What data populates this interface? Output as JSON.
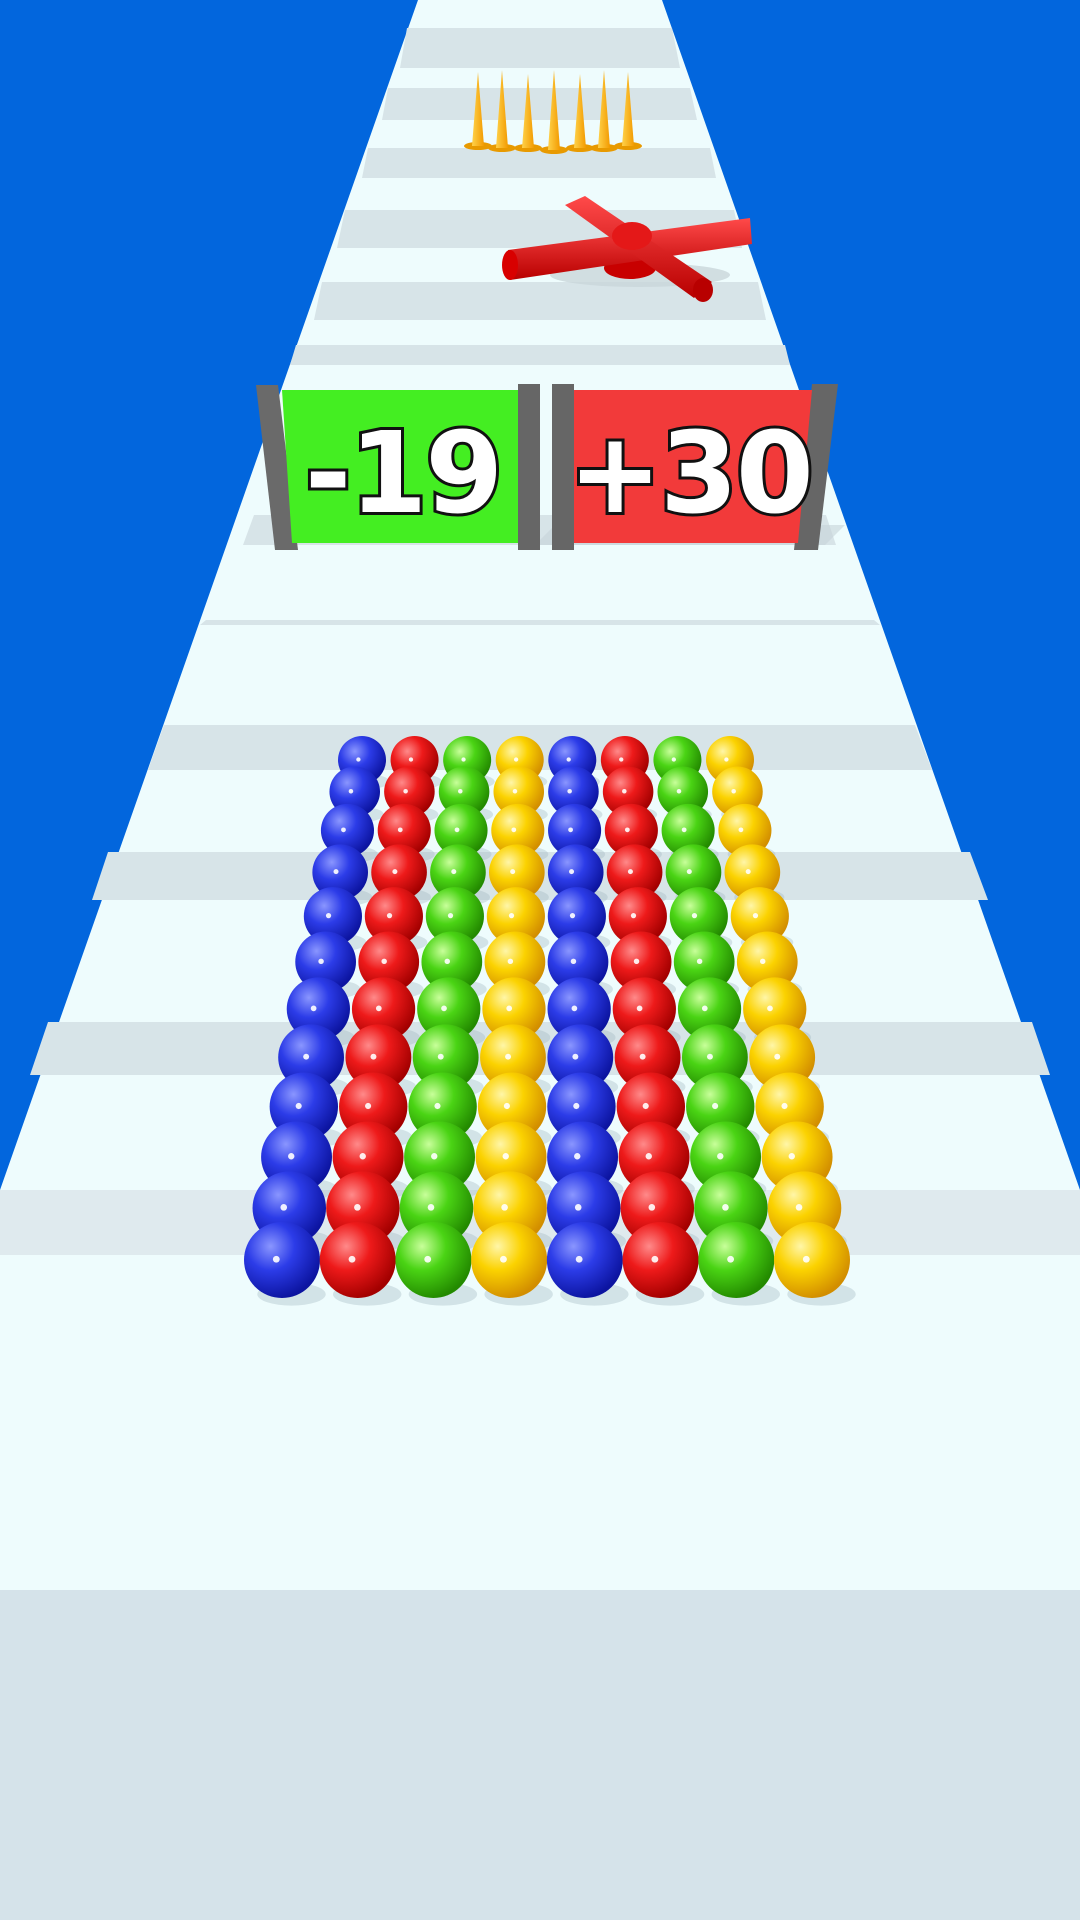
{
  "game": {
    "gates": [
      {
        "label": "-19",
        "color": "#44ee22",
        "kind": "subtract"
      },
      {
        "label": "+30",
        "color": "#f23a3a",
        "kind": "add"
      }
    ],
    "obstacles": [
      {
        "type": "spike-row",
        "count": 7,
        "color": "#ffbb22"
      },
      {
        "type": "rotating-cross-bar",
        "color": "#ee2222"
      }
    ],
    "ball_crowd": {
      "column_colors": [
        "blue",
        "red",
        "green",
        "yellow",
        "blue",
        "red",
        "green",
        "yellow"
      ],
      "rows": 12
    }
  },
  "colors": {
    "sky": "#0266dd",
    "track_light": "#eefcfd",
    "track_stripe": "#d4e1e6",
    "blue": "#1e2fd6",
    "red": "#e01010",
    "green": "#42cc10",
    "yellow": "#f5c800"
  }
}
